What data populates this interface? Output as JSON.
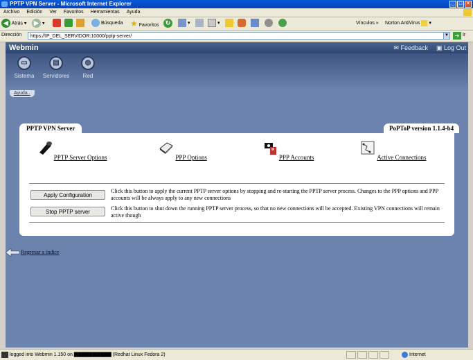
{
  "window": {
    "title": "PPTP VPN Server - Microsoft Internet Explorer"
  },
  "menu": [
    "Archivo",
    "Edición",
    "Ver",
    "Favoritos",
    "Herramientas",
    "Ayuda"
  ],
  "toolbar": {
    "back": "Atrás",
    "search": "Búsqueda",
    "favorites": "Favoritos",
    "links": "Vínculos",
    "antivirus": "Norton AntiVirus"
  },
  "address": {
    "label": "Dirección",
    "url": "https://IP_DEL_SERVIDOR:10000/pptp-server/",
    "go": "Ir"
  },
  "webmin": {
    "logo": "Webmin",
    "feedback": "Feedback",
    "logout": "Log Out",
    "categories": [
      "Sistema",
      "Servidores",
      "Red"
    ],
    "help": "Ayuda.."
  },
  "module": {
    "title": "PPTP VPN Server",
    "version": "PoPToP version 1.1.4-b4",
    "options": [
      {
        "label": "PPTP Server Options",
        "icon": "server-options-icon"
      },
      {
        "label": "PPP Options",
        "icon": "ppp-options-icon"
      },
      {
        "label": "PPP Accounts",
        "icon": "ppp-accounts-icon"
      },
      {
        "label": "Active Connections",
        "icon": "active-connections-icon"
      }
    ],
    "actions": [
      {
        "button": "Apply Configuration",
        "description": "Click this button to apply the current PPTP server options by stopping and re-starting the PPTP server process. Changes to the PPP options and PPP accounts will be always apply to any new connections"
      },
      {
        "button": "Stop PPTP server",
        "description": "Click this button to shut down the running PPTP server process, so that no new connections will be accepted. Existing VPN connections will remain active though"
      }
    ],
    "back_link": "Regresar a índice"
  },
  "status": {
    "text": "logged into Webmin 1.150 on",
    "os": "(Redhat Linux Fedora 2)",
    "zone": "Internet"
  },
  "colors": {
    "content_bg": "#6b83ad",
    "title_blue": "#0842b8"
  }
}
